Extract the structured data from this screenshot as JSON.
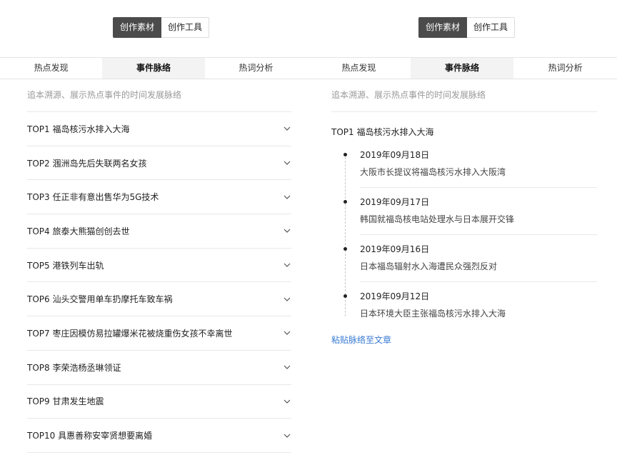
{
  "left_panel": {
    "segmented": {
      "active_label": "创作素材",
      "other_label": "创作工具"
    },
    "tabs": [
      "热点发现",
      "事件脉络",
      "热词分析"
    ],
    "active_tab": "事件脉络",
    "description": "追本溯源、展示热点事件的时间发展脉络",
    "items": [
      "TOP1 福岛核污水排入大海",
      "TOP2 涠洲岛先后失联两名女孩",
      "TOP3 任正非有意出售华为5G技术",
      "TOP4 旅泰大熊猫创创去世",
      "TOP5 港铁列车出轨",
      "TOP6 汕头交警用单车扔摩托车致车祸",
      "TOP7 枣庄因模仿易拉罐爆米花被烧重伤女孩不幸离世",
      "TOP8 李荣浩杨丞琳领证",
      "TOP9 甘肃发生地震",
      "TOP10 具惠善称安宰贤想要离婚"
    ]
  },
  "right_panel": {
    "segmented": {
      "active_label": "创作素材",
      "other_label": "创作工具"
    },
    "tabs": [
      "热点发现",
      "事件脉络",
      "热词分析"
    ],
    "active_tab": "事件脉络",
    "description": "追本溯源、展示热点事件的时间发展脉络",
    "expanded_item": "TOP1 福岛核污水排入大海",
    "timeline": [
      {
        "date": "2019年09月18日",
        "text": "大阪市长提议将福岛核污水排入大阪湾"
      },
      {
        "date": "2019年09月17日",
        "text": "韩国就福岛核电站处理水与日本展开交锋"
      },
      {
        "date": "2019年09月16日",
        "text": "日本福岛辐射水入海遭民众强烈反对"
      },
      {
        "date": "2019年09月12日",
        "text": "日本环境大臣主张福岛核污水排入大海"
      }
    ],
    "paste_link": "粘贴脉络至文章"
  },
  "icons": {
    "collapse": "chevron-down-icon",
    "timeline_marker": "dot-icon"
  }
}
